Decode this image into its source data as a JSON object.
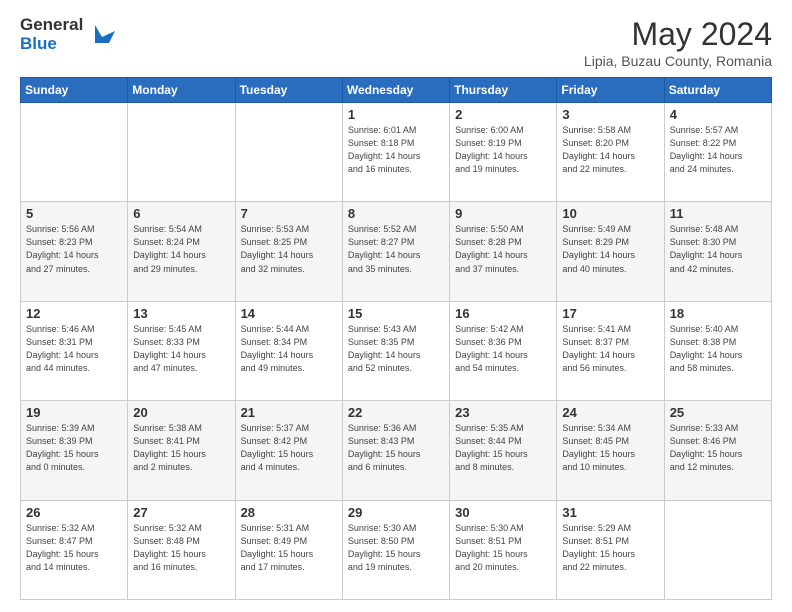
{
  "header": {
    "logo_general": "General",
    "logo_blue": "Blue",
    "month_title": "May 2024",
    "location": "Lipia, Buzau County, Romania"
  },
  "days_of_week": [
    "Sunday",
    "Monday",
    "Tuesday",
    "Wednesday",
    "Thursday",
    "Friday",
    "Saturday"
  ],
  "weeks": [
    {
      "days": [
        {
          "num": "",
          "info": ""
        },
        {
          "num": "",
          "info": ""
        },
        {
          "num": "",
          "info": ""
        },
        {
          "num": "1",
          "info": "Sunrise: 6:01 AM\nSunset: 8:18 PM\nDaylight: 14 hours\nand 16 minutes."
        },
        {
          "num": "2",
          "info": "Sunrise: 6:00 AM\nSunset: 8:19 PM\nDaylight: 14 hours\nand 19 minutes."
        },
        {
          "num": "3",
          "info": "Sunrise: 5:58 AM\nSunset: 8:20 PM\nDaylight: 14 hours\nand 22 minutes."
        },
        {
          "num": "4",
          "info": "Sunrise: 5:57 AM\nSunset: 8:22 PM\nDaylight: 14 hours\nand 24 minutes."
        }
      ]
    },
    {
      "days": [
        {
          "num": "5",
          "info": "Sunrise: 5:56 AM\nSunset: 8:23 PM\nDaylight: 14 hours\nand 27 minutes."
        },
        {
          "num": "6",
          "info": "Sunrise: 5:54 AM\nSunset: 8:24 PM\nDaylight: 14 hours\nand 29 minutes."
        },
        {
          "num": "7",
          "info": "Sunrise: 5:53 AM\nSunset: 8:25 PM\nDaylight: 14 hours\nand 32 minutes."
        },
        {
          "num": "8",
          "info": "Sunrise: 5:52 AM\nSunset: 8:27 PM\nDaylight: 14 hours\nand 35 minutes."
        },
        {
          "num": "9",
          "info": "Sunrise: 5:50 AM\nSunset: 8:28 PM\nDaylight: 14 hours\nand 37 minutes."
        },
        {
          "num": "10",
          "info": "Sunrise: 5:49 AM\nSunset: 8:29 PM\nDaylight: 14 hours\nand 40 minutes."
        },
        {
          "num": "11",
          "info": "Sunrise: 5:48 AM\nSunset: 8:30 PM\nDaylight: 14 hours\nand 42 minutes."
        }
      ]
    },
    {
      "days": [
        {
          "num": "12",
          "info": "Sunrise: 5:46 AM\nSunset: 8:31 PM\nDaylight: 14 hours\nand 44 minutes."
        },
        {
          "num": "13",
          "info": "Sunrise: 5:45 AM\nSunset: 8:33 PM\nDaylight: 14 hours\nand 47 minutes."
        },
        {
          "num": "14",
          "info": "Sunrise: 5:44 AM\nSunset: 8:34 PM\nDaylight: 14 hours\nand 49 minutes."
        },
        {
          "num": "15",
          "info": "Sunrise: 5:43 AM\nSunset: 8:35 PM\nDaylight: 14 hours\nand 52 minutes."
        },
        {
          "num": "16",
          "info": "Sunrise: 5:42 AM\nSunset: 8:36 PM\nDaylight: 14 hours\nand 54 minutes."
        },
        {
          "num": "17",
          "info": "Sunrise: 5:41 AM\nSunset: 8:37 PM\nDaylight: 14 hours\nand 56 minutes."
        },
        {
          "num": "18",
          "info": "Sunrise: 5:40 AM\nSunset: 8:38 PM\nDaylight: 14 hours\nand 58 minutes."
        }
      ]
    },
    {
      "days": [
        {
          "num": "19",
          "info": "Sunrise: 5:39 AM\nSunset: 8:39 PM\nDaylight: 15 hours\nand 0 minutes."
        },
        {
          "num": "20",
          "info": "Sunrise: 5:38 AM\nSunset: 8:41 PM\nDaylight: 15 hours\nand 2 minutes."
        },
        {
          "num": "21",
          "info": "Sunrise: 5:37 AM\nSunset: 8:42 PM\nDaylight: 15 hours\nand 4 minutes."
        },
        {
          "num": "22",
          "info": "Sunrise: 5:36 AM\nSunset: 8:43 PM\nDaylight: 15 hours\nand 6 minutes."
        },
        {
          "num": "23",
          "info": "Sunrise: 5:35 AM\nSunset: 8:44 PM\nDaylight: 15 hours\nand 8 minutes."
        },
        {
          "num": "24",
          "info": "Sunrise: 5:34 AM\nSunset: 8:45 PM\nDaylight: 15 hours\nand 10 minutes."
        },
        {
          "num": "25",
          "info": "Sunrise: 5:33 AM\nSunset: 8:46 PM\nDaylight: 15 hours\nand 12 minutes."
        }
      ]
    },
    {
      "days": [
        {
          "num": "26",
          "info": "Sunrise: 5:32 AM\nSunset: 8:47 PM\nDaylight: 15 hours\nand 14 minutes."
        },
        {
          "num": "27",
          "info": "Sunrise: 5:32 AM\nSunset: 8:48 PM\nDaylight: 15 hours\nand 16 minutes."
        },
        {
          "num": "28",
          "info": "Sunrise: 5:31 AM\nSunset: 8:49 PM\nDaylight: 15 hours\nand 17 minutes."
        },
        {
          "num": "29",
          "info": "Sunrise: 5:30 AM\nSunset: 8:50 PM\nDaylight: 15 hours\nand 19 minutes."
        },
        {
          "num": "30",
          "info": "Sunrise: 5:30 AM\nSunset: 8:51 PM\nDaylight: 15 hours\nand 20 minutes."
        },
        {
          "num": "31",
          "info": "Sunrise: 5:29 AM\nSunset: 8:51 PM\nDaylight: 15 hours\nand 22 minutes."
        },
        {
          "num": "",
          "info": ""
        }
      ]
    }
  ]
}
